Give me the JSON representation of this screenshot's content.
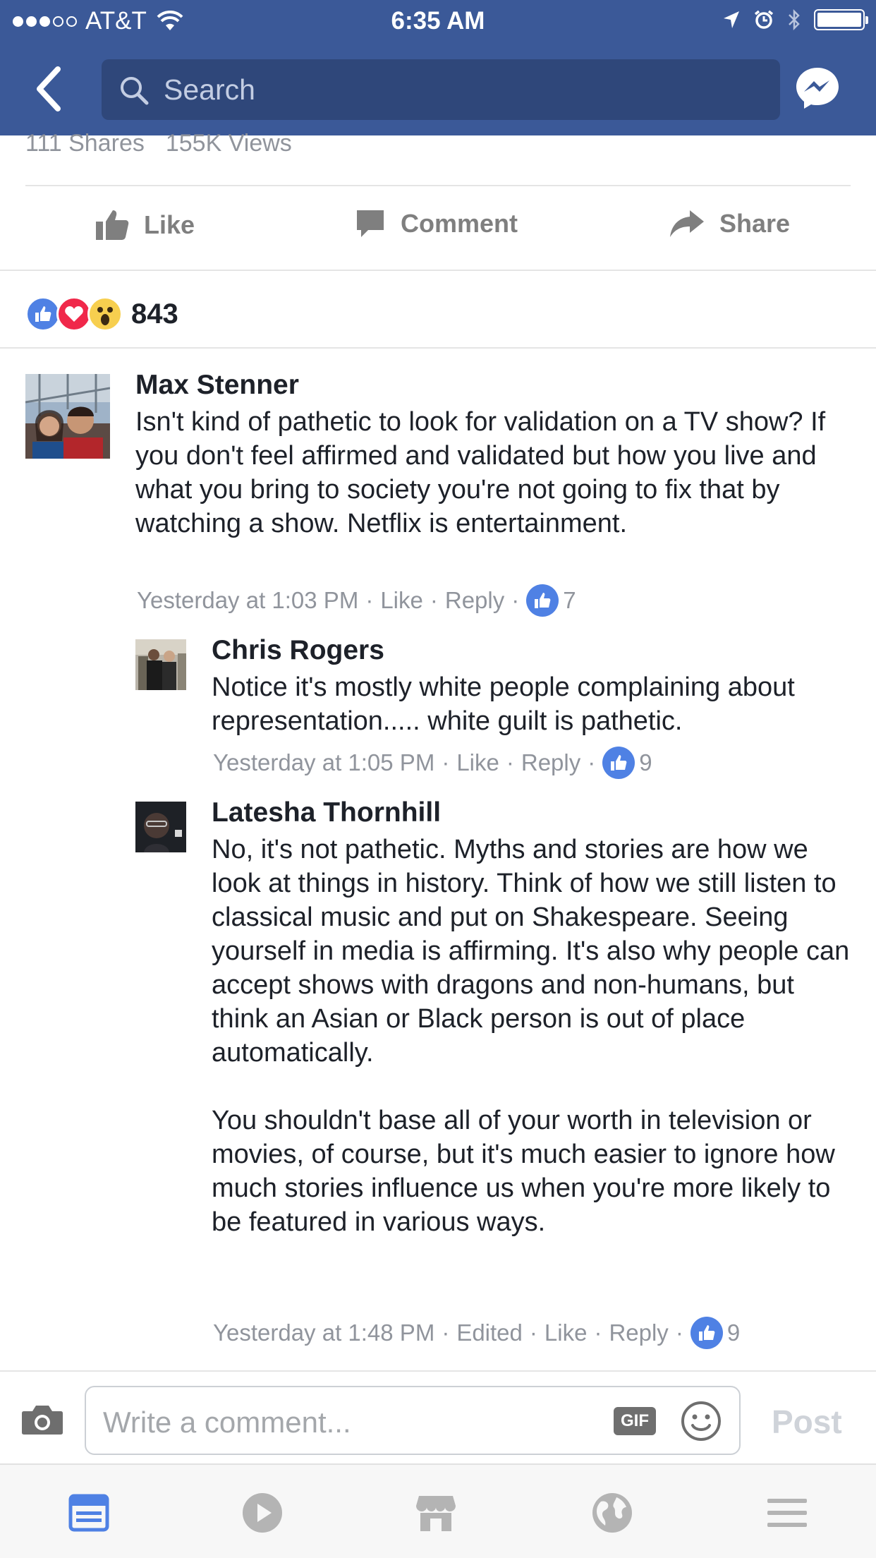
{
  "status_bar": {
    "carrier": "AT&T",
    "time": "6:35 AM"
  },
  "header": {
    "search_placeholder": "Search"
  },
  "post_stats": {
    "shares": "111 Shares",
    "views": "155K Views"
  },
  "actions": {
    "like": "Like",
    "comment": "Comment",
    "share": "Share"
  },
  "reactions": {
    "count": "843",
    "types": [
      "like",
      "love",
      "wow"
    ]
  },
  "comments": [
    {
      "author": "Max Stenner",
      "text": "Isn't kind of pathetic to look for validation on a TV show? If you don't feel affirmed and validated but how you live and what you bring to society you're not going to fix that by watching a show. Netflix is entertainment.",
      "timestamp": "Yesterday at 1:03 PM",
      "like_label": "Like",
      "reply_label": "Reply",
      "likes": "7"
    },
    {
      "author": "Chris Rogers",
      "text": "Notice it's mostly white people complaining about representation..... white guilt is pathetic.",
      "timestamp": "Yesterday at 1:05 PM",
      "like_label": "Like",
      "reply_label": "Reply",
      "likes": "9"
    },
    {
      "author": "Latesha Thornhill",
      "text": "No, it's not pathetic. Myths and stories are how we look at things in history. Think of how we still listen to classical music and put on Shakespeare. Seeing yourself in media is affirming. It's also why people can accept shows with dragons and non-humans, but think an Asian or Black person is out of place automatically.\n\nYou shouldn't base all of your worth in television or movies, of course, but it's much easier to ignore how much stories influence us when you're more likely to be featured in various ways.",
      "timestamp": "Yesterday at 1:48 PM",
      "edited": "Edited",
      "like_label": "Like",
      "reply_label": "Reply",
      "likes": "9"
    }
  ],
  "composer": {
    "placeholder": "Write a comment...",
    "gif_label": "GIF",
    "post_label": "Post"
  },
  "tabbar": {
    "icons": [
      "news-feed-icon",
      "video-icon",
      "marketplace-icon",
      "notifications-globe-icon",
      "menu-icon"
    ]
  },
  "colors": {
    "brand": "#3b5998",
    "like_blue": "#4f81e4",
    "love_red": "#f0284a",
    "wow_yellow": "#f7cf4f",
    "meta_gray": "#90949c"
  }
}
